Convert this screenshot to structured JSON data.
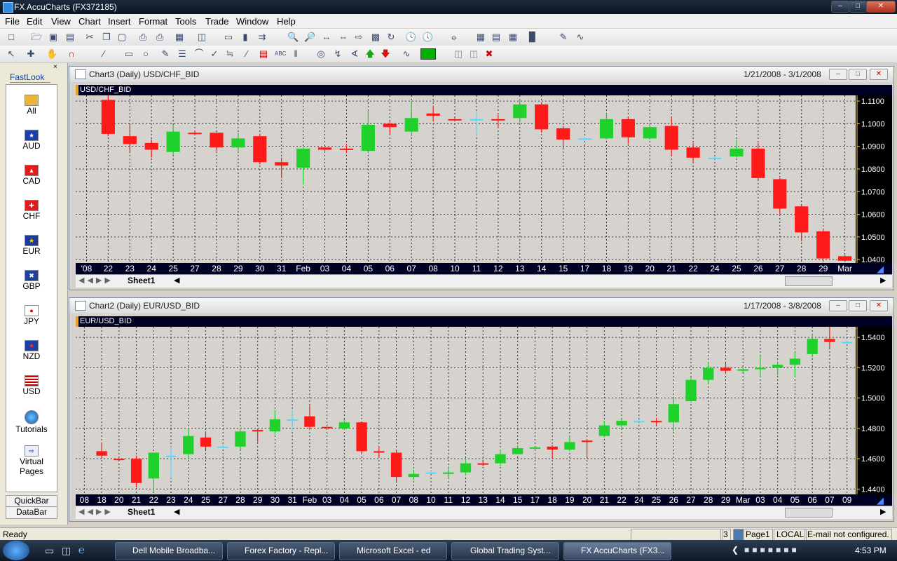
{
  "window": {
    "title": "FX AccuCharts (FX372185)"
  },
  "menu": [
    "File",
    "Edit",
    "View",
    "Chart",
    "Insert",
    "Format",
    "Tools",
    "Trade",
    "Window",
    "Help"
  ],
  "fastlook": {
    "tab": "FastLook",
    "items": [
      {
        "label": "All",
        "icon": "gold-coins-icon"
      },
      {
        "label": "AUD",
        "icon": "flag-aud-icon"
      },
      {
        "label": "CAD",
        "icon": "flag-cad-icon"
      },
      {
        "label": "CHF",
        "icon": "flag-chf-icon"
      },
      {
        "label": "EUR",
        "icon": "flag-eur-icon"
      },
      {
        "label": "GBP",
        "icon": "flag-gbp-icon"
      },
      {
        "label": "JPY",
        "icon": "flag-jpy-icon"
      },
      {
        "label": "NZD",
        "icon": "flag-nzd-icon"
      },
      {
        "label": "USD",
        "icon": "flag-usd-icon"
      },
      {
        "label": "Tutorials",
        "icon": "globe-icon"
      },
      {
        "label": "Virtual Pages",
        "icon": "virtual-pages-icon"
      }
    ],
    "bottom_tabs": [
      "QuickBar",
      "DataBar"
    ]
  },
  "chart1": {
    "title": "Chart3 (Daily)  USD/CHF_BID",
    "date_range": "1/21/2008 - 3/1/2008",
    "symbol": "USD/CHF_BID",
    "sheet": "Sheet1",
    "y_ticks": [
      "1.1100",
      "1.1000",
      "1.0900",
      "1.0800",
      "1.0700",
      "1.0600",
      "1.0500",
      "1.0400"
    ],
    "x_labels": [
      "'08",
      "22",
      "23",
      "24",
      "25",
      "27",
      "28",
      "29",
      "30",
      "31",
      "Feb",
      "03",
      "04",
      "05",
      "06",
      "07",
      "08",
      "10",
      "11",
      "12",
      "13",
      "14",
      "15",
      "17",
      "18",
      "19",
      "20",
      "21",
      "22",
      "24",
      "25",
      "26",
      "27",
      "28",
      "29",
      "Mar"
    ]
  },
  "chart2": {
    "title": "Chart2 (Daily)  EUR/USD_BID",
    "date_range": "1/17/2008 - 3/8/2008",
    "symbol": "EUR/USD_BID",
    "sheet": "Sheet1",
    "y_ticks": [
      "1.5400",
      "1.5200",
      "1.5000",
      "1.4800",
      "1.4600",
      "1.4400"
    ],
    "x_labels": [
      "08",
      "18",
      "20",
      "21",
      "22",
      "23",
      "24",
      "25",
      "27",
      "28",
      "29",
      "30",
      "31",
      "Feb",
      "03",
      "04",
      "05",
      "06",
      "07",
      "08",
      "10",
      "11",
      "12",
      "13",
      "14",
      "15",
      "17",
      "18",
      "19",
      "20",
      "21",
      "22",
      "24",
      "25",
      "26",
      "27",
      "28",
      "29",
      "Mar",
      "03",
      "04",
      "05",
      "06",
      "07",
      "09"
    ]
  },
  "colors": {
    "up": "#1fd12a",
    "down": "#ff1a1a",
    "doji": "#5ad6ff",
    "bg": "#000000"
  },
  "chart_data": [
    {
      "type": "candlestick",
      "title": "USD/CHF_BID",
      "ylim": [
        1.0385,
        1.1125
      ],
      "candles": [
        {
          "o": 1.1105,
          "h": 1.113,
          "l": 1.0945,
          "c": 1.0955
        },
        {
          "o": 1.0945,
          "h": 1.0995,
          "l": 1.087,
          "c": 1.091
        },
        {
          "o": 1.0915,
          "h": 1.093,
          "l": 1.085,
          "c": 1.0885
        },
        {
          "o": 1.0875,
          "h": 1.0995,
          "l": 1.086,
          "c": 1.0965
        },
        {
          "o": 1.096,
          "h": 1.097,
          "l": 1.095,
          "c": 1.0955
        },
        {
          "o": 1.096,
          "h": 1.096,
          "l": 1.088,
          "c": 1.0895
        },
        {
          "o": 1.0895,
          "h": 1.096,
          "l": 1.088,
          "c": 1.0935
        },
        {
          "o": 1.0945,
          "h": 1.0955,
          "l": 1.082,
          "c": 1.083
        },
        {
          "o": 1.083,
          "h": 1.085,
          "l": 1.076,
          "c": 1.0815
        },
        {
          "o": 1.0805,
          "h": 1.0895,
          "l": 1.073,
          "c": 1.089
        },
        {
          "o": 1.0895,
          "h": 1.0895,
          "l": 1.088,
          "c": 1.0885
        },
        {
          "o": 1.089,
          "h": 1.091,
          "l": 1.087,
          "c": 1.0885
        },
        {
          "o": 1.088,
          "h": 1.106,
          "l": 1.087,
          "c": 1.0995
        },
        {
          "o": 1.1,
          "h": 1.101,
          "l": 1.0955,
          "c": 1.0985
        },
        {
          "o": 1.0965,
          "h": 1.11,
          "l": 1.0945,
          "c": 1.1025
        },
        {
          "o": 1.1045,
          "h": 1.108,
          "l": 1.101,
          "c": 1.1035
        },
        {
          "o": 1.102,
          "h": 1.1025,
          "l": 1.101,
          "c": 1.1015
        },
        {
          "o": 1.102,
          "h": 1.105,
          "l": 1.095,
          "c": 1.102
        },
        {
          "o": 1.102,
          "h": 1.104,
          "l": 1.0985,
          "c": 1.1015
        },
        {
          "o": 1.1025,
          "h": 1.111,
          "l": 1.1005,
          "c": 1.1085
        },
        {
          "o": 1.1085,
          "h": 1.109,
          "l": 1.096,
          "c": 1.0975
        },
        {
          "o": 1.098,
          "h": 1.099,
          "l": 1.0885,
          "c": 1.093
        },
        {
          "o": 1.0935,
          "h": 1.094,
          "l": 1.093,
          "c": 1.0935
        },
        {
          "o": 1.0935,
          "h": 1.1045,
          "l": 1.093,
          "c": 1.102
        },
        {
          "o": 1.102,
          "h": 1.103,
          "l": 1.091,
          "c": 1.094
        },
        {
          "o": 1.0935,
          "h": 1.1005,
          "l": 1.093,
          "c": 1.0985
        },
        {
          "o": 1.099,
          "h": 1.103,
          "l": 1.086,
          "c": 1.0885
        },
        {
          "o": 1.0895,
          "h": 1.0915,
          "l": 1.083,
          "c": 1.085
        },
        {
          "o": 1.085,
          "h": 1.0855,
          "l": 1.0845,
          "c": 1.085
        },
        {
          "o": 1.0855,
          "h": 1.093,
          "l": 1.085,
          "c": 1.089
        },
        {
          "o": 1.089,
          "h": 1.0915,
          "l": 1.075,
          "c": 1.076
        },
        {
          "o": 1.0755,
          "h": 1.076,
          "l": 1.06,
          "c": 1.0625
        },
        {
          "o": 1.0635,
          "h": 1.064,
          "l": 1.048,
          "c": 1.052
        },
        {
          "o": 1.0525,
          "h": 1.053,
          "l": 1.04,
          "c": 1.0405
        },
        {
          "o": 1.0415,
          "h": 1.042,
          "l": 1.039,
          "c": 1.0395
        }
      ]
    },
    {
      "type": "candlestick",
      "title": "EUR/USD_BID",
      "ylim": [
        1.4365,
        1.547
      ],
      "candles": [
        {
          "o": 1.465,
          "h": 1.47,
          "l": 1.46,
          "c": 1.462
        },
        {
          "o": 1.46,
          "h": 1.46,
          "l": 1.46,
          "c": 1.4595
        },
        {
          "o": 1.46,
          "h": 1.462,
          "l": 1.441,
          "c": 1.444
        },
        {
          "o": 1.447,
          "h": 1.464,
          "l": 1.438,
          "c": 1.464
        },
        {
          "o": 1.462,
          "h": 1.468,
          "l": 1.447,
          "c": 1.462
        },
        {
          "o": 1.463,
          "h": 1.48,
          "l": 1.46,
          "c": 1.475
        },
        {
          "o": 1.474,
          "h": 1.478,
          "l": 1.466,
          "c": 1.468
        },
        {
          "o": 1.468,
          "h": 1.469,
          "l": 1.468,
          "c": 1.468
        },
        {
          "o": 1.468,
          "h": 1.48,
          "l": 1.466,
          "c": 1.478
        },
        {
          "o": 1.479,
          "h": 1.48,
          "l": 1.471,
          "c": 1.478
        },
        {
          "o": 1.478,
          "h": 1.492,
          "l": 1.476,
          "c": 1.486
        },
        {
          "o": 1.486,
          "h": 1.492,
          "l": 1.478,
          "c": 1.486
        },
        {
          "o": 1.488,
          "h": 1.495,
          "l": 1.479,
          "c": 1.481
        },
        {
          "o": 1.481,
          "h": 1.481,
          "l": 1.48,
          "c": 1.4805
        },
        {
          "o": 1.48,
          "h": 1.486,
          "l": 1.479,
          "c": 1.484
        },
        {
          "o": 1.484,
          "h": 1.484,
          "l": 1.463,
          "c": 1.465
        },
        {
          "o": 1.465,
          "h": 1.468,
          "l": 1.461,
          "c": 1.464
        },
        {
          "o": 1.464,
          "h": 1.466,
          "l": 1.444,
          "c": 1.448
        },
        {
          "o": 1.448,
          "h": 1.453,
          "l": 1.446,
          "c": 1.45
        },
        {
          "o": 1.451,
          "h": 1.452,
          "l": 1.45,
          "c": 1.451
        },
        {
          "o": 1.45,
          "h": 1.455,
          "l": 1.447,
          "c": 1.451
        },
        {
          "o": 1.451,
          "h": 1.46,
          "l": 1.449,
          "c": 1.457
        },
        {
          "o": 1.457,
          "h": 1.459,
          "l": 1.455,
          "c": 1.4565
        },
        {
          "o": 1.457,
          "h": 1.466,
          "l": 1.455,
          "c": 1.463
        },
        {
          "o": 1.463,
          "h": 1.469,
          "l": 1.463,
          "c": 1.467
        },
        {
          "o": 1.467,
          "h": 1.468,
          "l": 1.466,
          "c": 1.4675
        },
        {
          "o": 1.468,
          "h": 1.469,
          "l": 1.46,
          "c": 1.466
        },
        {
          "o": 1.466,
          "h": 1.475,
          "l": 1.465,
          "c": 1.471
        },
        {
          "o": 1.472,
          "h": 1.473,
          "l": 1.46,
          "c": 1.471
        },
        {
          "o": 1.475,
          "h": 1.485,
          "l": 1.474,
          "c": 1.482
        },
        {
          "o": 1.482,
          "h": 1.486,
          "l": 1.48,
          "c": 1.485
        },
        {
          "o": 1.485,
          "h": 1.486,
          "l": 1.484,
          "c": 1.485
        },
        {
          "o": 1.485,
          "h": 1.487,
          "l": 1.482,
          "c": 1.484
        },
        {
          "o": 1.484,
          "h": 1.5,
          "l": 1.478,
          "c": 1.496
        },
        {
          "o": 1.498,
          "h": 1.514,
          "l": 1.497,
          "c": 1.512
        },
        {
          "o": 1.512,
          "h": 1.524,
          "l": 1.509,
          "c": 1.52
        },
        {
          "o": 1.52,
          "h": 1.523,
          "l": 1.516,
          "c": 1.518
        },
        {
          "o": 1.518,
          "h": 1.52,
          "l": 1.517,
          "c": 1.519
        },
        {
          "o": 1.519,
          "h": 1.528,
          "l": 1.514,
          "c": 1.52
        },
        {
          "o": 1.52,
          "h": 1.524,
          "l": 1.515,
          "c": 1.522
        },
        {
          "o": 1.522,
          "h": 1.53,
          "l": 1.514,
          "c": 1.526
        },
        {
          "o": 1.529,
          "h": 1.542,
          "l": 1.527,
          "c": 1.539
        },
        {
          "o": 1.539,
          "h": 1.547,
          "l": 1.533,
          "c": 1.537
        },
        {
          "o": 1.537,
          "h": 1.538,
          "l": 1.536,
          "c": 1.537
        }
      ]
    }
  ],
  "statusbar": {
    "left": "Ready",
    "num": "3",
    "page": "Page1",
    "zone": "LOCAL",
    "email": "E-mail not configured."
  },
  "taskbar": {
    "tasks": [
      "Dell Mobile Broadba...",
      "Forex Factory - Repl...",
      "Microsoft Excel - ed",
      "Global Trading Syst...",
      "FX AccuCharts (FX3..."
    ],
    "clock": "4:53 PM"
  }
}
